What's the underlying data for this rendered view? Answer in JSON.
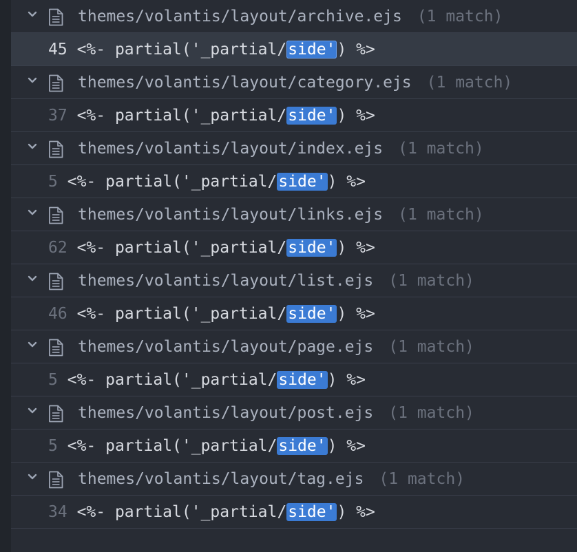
{
  "results": [
    {
      "path": "themes/volantis/layout/archive.ejs",
      "count": "(1 match)",
      "line": "45",
      "before": "<%- partial('_partial/",
      "match": "side'",
      "after": ") %>",
      "selected": true
    },
    {
      "path": "themes/volantis/layout/category.ejs",
      "count": "(1 match)",
      "line": "37",
      "before": "<%- partial('_partial/",
      "match": "side'",
      "after": ") %>"
    },
    {
      "path": "themes/volantis/layout/index.ejs",
      "count": "(1 match)",
      "line": "5",
      "before": "<%- partial('_partial/",
      "match": "side'",
      "after": ") %>"
    },
    {
      "path": "themes/volantis/layout/links.ejs",
      "count": "(1 match)",
      "line": "62",
      "before": "<%- partial('_partial/",
      "match": "side'",
      "after": ") %>"
    },
    {
      "path": "themes/volantis/layout/list.ejs",
      "count": "(1 match)",
      "line": "46",
      "before": "<%- partial('_partial/",
      "match": "side'",
      "after": ") %>"
    },
    {
      "path": "themes/volantis/layout/page.ejs",
      "count": "(1 match)",
      "line": "5",
      "before": "<%- partial('_partial/",
      "match": "side'",
      "after": ") %>"
    },
    {
      "path": "themes/volantis/layout/post.ejs",
      "count": "(1 match)",
      "line": "5",
      "before": "<%- partial('_partial/",
      "match": "side'",
      "after": ") %>"
    },
    {
      "path": "themes/volantis/layout/tag.ejs",
      "count": "(1 match)",
      "line": "34",
      "before": "<%- partial('_partial/",
      "match": "side'",
      "after": ") %>"
    }
  ],
  "colors": {
    "background": "#282c34",
    "highlight": "#3b7bd4",
    "selected_row": "#353b45"
  },
  "icons": {
    "expand": "chevron-down-icon",
    "file": "file-text-icon"
  }
}
